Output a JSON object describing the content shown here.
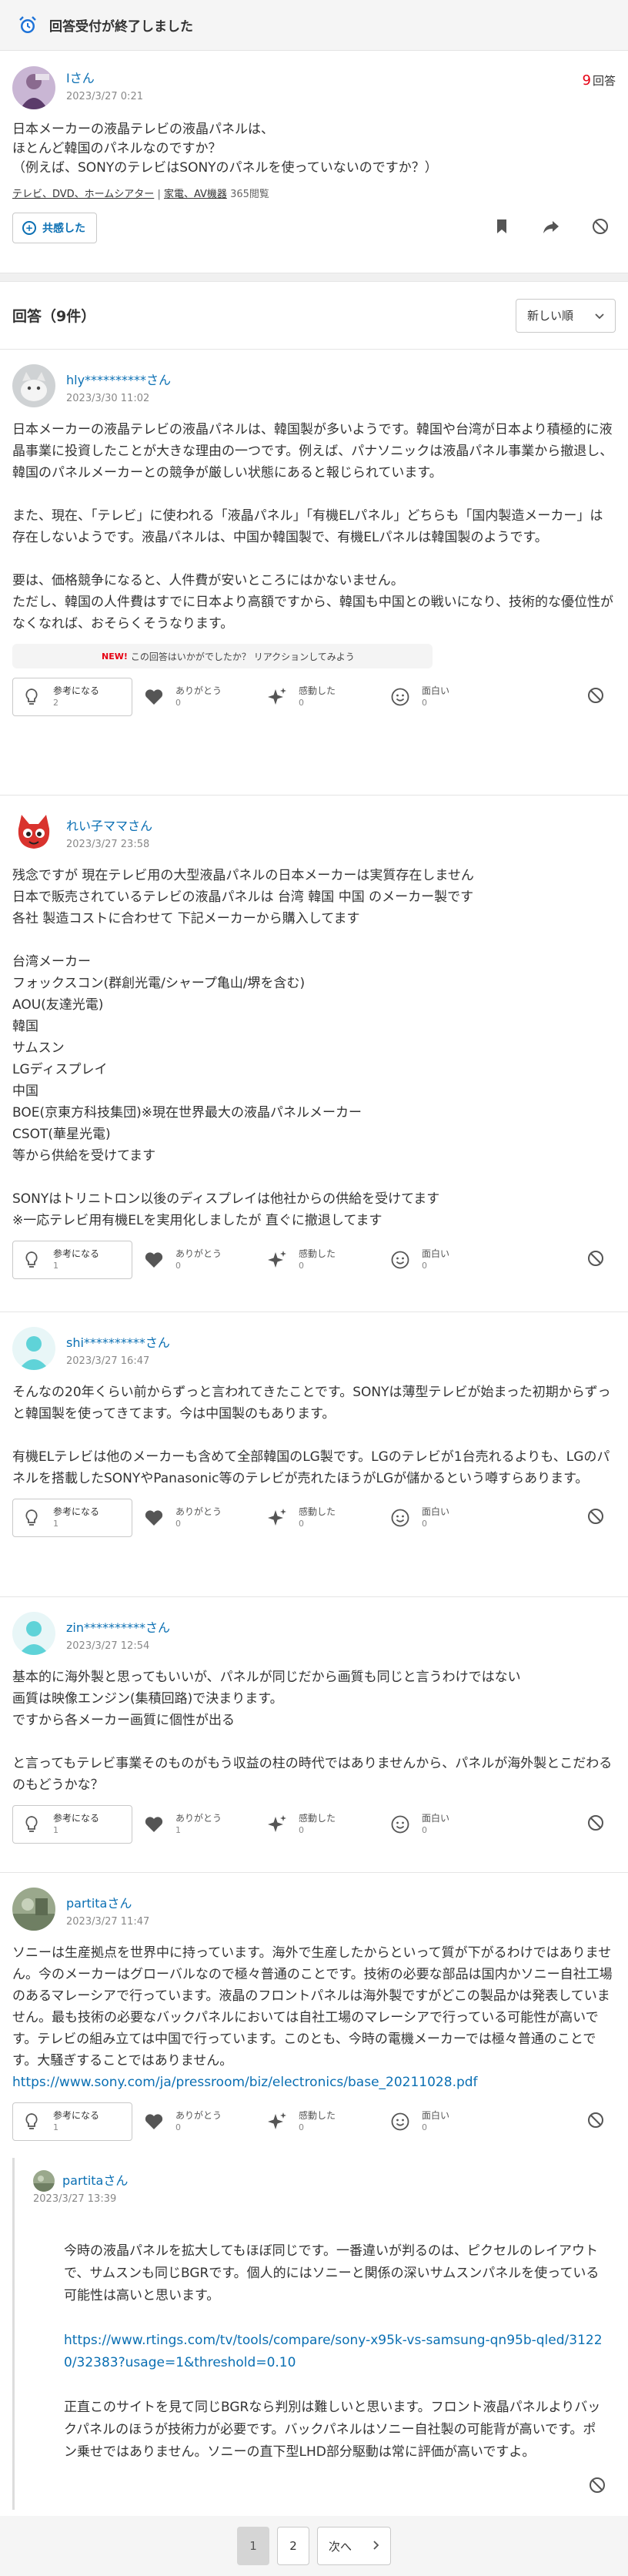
{
  "notice": {
    "text": "回答受付が終了しました",
    "icon": "alarm-clock-icon"
  },
  "question": {
    "user": "Iさん",
    "date": "2023/3/27 0:21",
    "answer_count": "9",
    "answer_count_label": "回答",
    "body": "日本メーカーの液晶テレビの液晶パネルは、\nほとんど韓国のパネルなのですか？\n（例えば、SONYのテレビはSONYのパネルを使っていないのですか？）",
    "category1": "テレビ、DVD、ホームシアター",
    "category_sep": "|",
    "category2": "家電、AV機器",
    "views": "365閲覧",
    "kyokan_label": "共感した"
  },
  "answers_header": {
    "title": "回答（9件）",
    "sort_label": "新しい順"
  },
  "reaction_labels": {
    "helpful": "参考になる",
    "thanks": "ありがとう",
    "impressed": "感動した",
    "funny": "面白い"
  },
  "answers": [
    {
      "user": "hly**********さん",
      "date": "2023/3/30 11:02",
      "body": "日本メーカーの液晶テレビの液晶パネルは、韓国製が多いようです。韓国や台湾が日本より積極的に液晶事業に投資したことが大きな理由の一つです。例えば、パナソニックは液晶パネル事業から撤退し、韓国のパネルメーカーとの競争が厳しい状態にあると報じられています。\n\nまた、現在、「テレビ」に使われる「液晶パネル」「有機ELパネル」どちらも「国内製造メーカー」は存在しないようです。液晶パネルは、中国か韓国製で、有機ELパネルは韓国製のようです。\n\n要は、価格競争になると、人件費が安いところにはかないません。\nただし、韓国の人件費はすでに日本より高額ですから、韓国も中国との戦いになり、技術的な優位性がなくなれば、おそらくそうなります。",
      "promo_new": "NEW!",
      "promo": "この回答はいかがでしたか？ リアクションしてみよう",
      "counts": {
        "helpful": "2",
        "thanks": "0",
        "impressed": "0",
        "funny": "0"
      }
    },
    {
      "user": "れい子ママさん",
      "date": "2023/3/27 23:58",
      "body": "残念ですが 現在テレビ用の大型液晶パネルの日本メーカーは実質存在しません\n日本で販売されているテレビの液晶パネルは 台湾 韓国 中国 のメーカー製です\n各社 製造コストに合わせて 下記メーカーから購入してます\n\n台湾メーカー\nフォックスコン(群創光電/シャープ亀山/堺を含む)\nAOU(友達光電)\n韓国\nサムスン\nLGディスプレイ\n中国\nBOE(京東方科技集団)※現在世界最大の液晶パネルメーカー\nCSOT(華星光電)\n等から供給を受けてます\n\nSONYはトリニトロン以後のディスプレイは他社からの供給を受けてます\n※一応テレビ用有機ELを実用化しましたが 直ぐに撤退してます",
      "counts": {
        "helpful": "1",
        "thanks": "0",
        "impressed": "0",
        "funny": "0"
      }
    },
    {
      "user": "shi**********さん",
      "date": "2023/3/27 16:47",
      "body": "そんなの20年くらい前からずっと言われてきたことです。SONYは薄型テレビが始まった初期からずっと韓国製を使ってきてます。今は中国製のもあります。\n\n有機ELテレビは他のメーカーも含めて全部韓国のLG製です。LGのテレビが1台売れるよりも、LGのパネルを搭載したSONYやPanasonic等のテレビが売れたほうがLGが儲かるという噂すらあります。",
      "counts": {
        "helpful": "1",
        "thanks": "0",
        "impressed": "0",
        "funny": "0"
      }
    },
    {
      "user": "zin**********さん",
      "date": "2023/3/27 12:54",
      "body": "基本的に海外製と思ってもいいが、パネルが同じだから画質も同じと言うわけではない\n画質は映像エンジン(集積回路)で決まります。\nですから各メーカー画質に個性が出る\n\nと言ってもテレビ事業そのものがもう収益の柱の時代ではありませんから、パネルが海外製とこだわるのもどうかな？",
      "counts": {
        "helpful": "1",
        "thanks": "1",
        "impressed": "0",
        "funny": "0"
      }
    },
    {
      "user": "partitaさん",
      "date": "2023/3/27 11:47",
      "body": "ソニーは生産拠点を世界中に持っています。海外で生産したからといって質が下がるわけではありません。今のメーカーはグローバルなので極々普通のことです。技術の必要な部品は国内かソニー自社工場のあるマレーシアで行っています。液晶のフロントパネルは海外製ですがどこの製品かは発表していません。最も技術の必要なバックパネルにおいては自社工場のマレーシアで行っている可能性が高いです。テレビの組み立ては中国で行っています。このとも、今時の電機メーカーでは極々普通のことです。大騒ぎすることではありません。",
      "link": "https://www.sony.com/ja/pressroom/biz/electronics/base_20211028.pdf",
      "counts": {
        "helpful": "1",
        "thanks": "0",
        "impressed": "0",
        "funny": "0"
      }
    }
  ],
  "reply": {
    "user": "partitaさん",
    "date": "2023/3/27 13:39",
    "body1": "今時の液晶パネルを拡大してもほぼ同じです。一番違いが判るのは、ピクセルのレイアウトで、サムスンも同じBGRです。個人的にはソニーと関係の深いサムスンパネルを使っている可能性は高いと思います。",
    "link": "https://www.rtings.com/tv/tools/compare/sony-x95k-vs-samsung-qn95b-qled/31220/32383?usage=1&threshold=0.10",
    "body2": "正直このサイトを見て同じBGRなら判別は難しいと思います。フロント液晶パネルよりバックパネルのほうが技術力が必要です。バックパネルはソニー自社製の可能背が高いです。ポン乗せではありません。ソニーの直下型LHD部分駆動は常に評価が高いですよ。"
  },
  "pager": {
    "page1": "1",
    "page2": "2",
    "next_label": "次へ"
  },
  "colors": {
    "link": "#0a6fb3",
    "count_accent": "#e60013",
    "notice_icon": "#1e73d8"
  }
}
